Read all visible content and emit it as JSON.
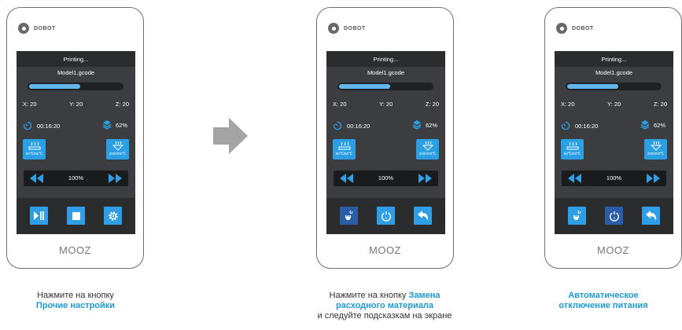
{
  "brand": {
    "name": "DOBOT"
  },
  "device_label": "MOOZ",
  "colors": {
    "accent": "#2f9ee6",
    "screen_bg": "#3b3d40",
    "highlight_text": "#1d9ad6"
  },
  "screen": {
    "status": "Printing...",
    "file": "Model1.gcode",
    "progress": 0.55,
    "x": "X: 20",
    "y": "Y: 20",
    "z": "Z: 20",
    "time": "00:16:20",
    "layer_percent": "62%",
    "bed_temp": "60℃/60℃",
    "nozzle_temp": "200/200℃",
    "speed": "100%"
  },
  "panels": [
    {
      "buttons": [
        "play-pause-icon",
        "stop-icon",
        "settings-gear-icon"
      ],
      "caption": {
        "line1": "Нажмите на кнопку",
        "highlight": "Прочие настройки"
      }
    },
    {
      "buttons": [
        "filament-change-icon",
        "auto-power-off-icon",
        "back-arrow-icon"
      ],
      "caption": {
        "prefix": "Нажмите на кнопку ",
        "hl1": "Замена",
        "hl2": "расходного материала",
        "line3": "и следуйте подсказкам на экране"
      }
    },
    {
      "buttons": [
        "filament-change-icon",
        "auto-power-off-icon",
        "back-arrow-icon"
      ],
      "caption": {
        "hl1": "Автоматическое",
        "hl2": "отключение питания"
      }
    }
  ]
}
